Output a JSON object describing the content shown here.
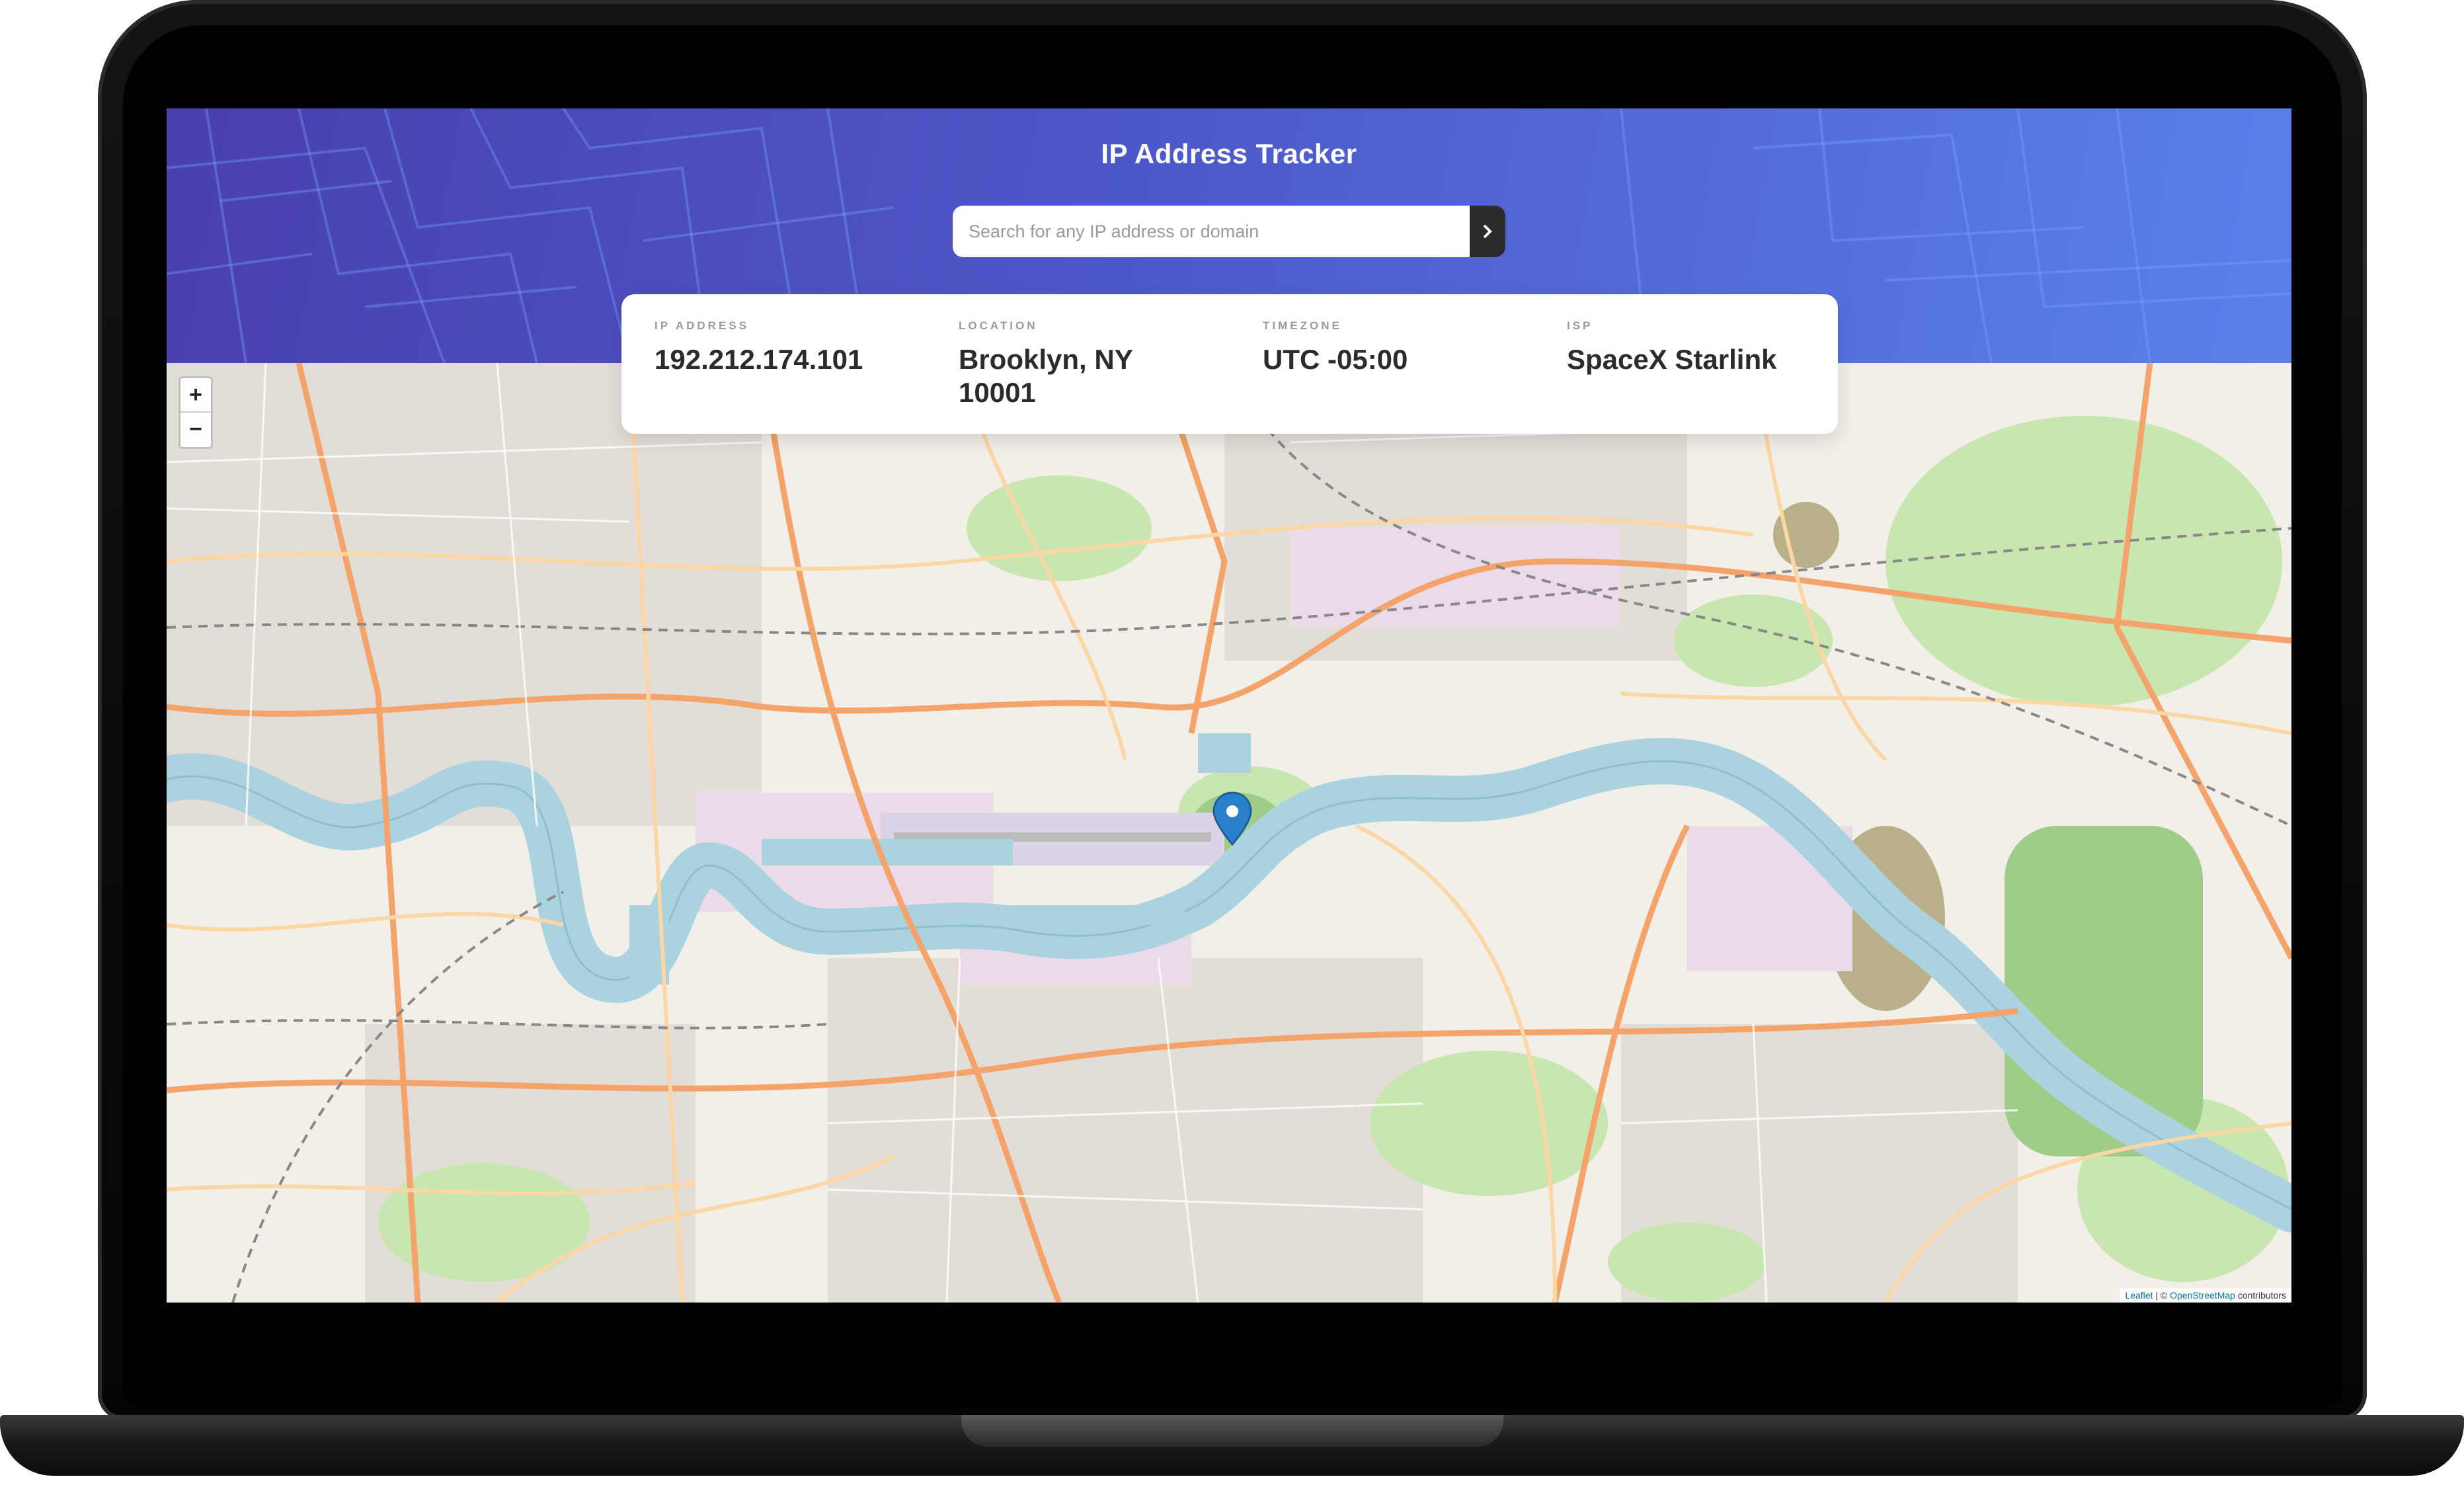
{
  "app": {
    "title": "IP Address Tracker"
  },
  "search": {
    "placeholder": "Search for any IP address or domain",
    "value": ""
  },
  "info": [
    {
      "label": "IP ADDRESS",
      "value": "192.212.174.101"
    },
    {
      "label": "LOCATION",
      "value": "Brooklyn, NY 10001"
    },
    {
      "label": "TIMEZONE",
      "value": "UTC -05:00"
    },
    {
      "label": "ISP",
      "value": "SpaceX Starlink"
    }
  ],
  "map": {
    "zoom_in": "+",
    "zoom_out": "−",
    "attribution": {
      "leaflet": "Leaflet",
      "separator": " | © ",
      "osm": "OpenStreetMap",
      "suffix": " contributors"
    },
    "colors": {
      "water": "#aad3df",
      "land": "#f2efe9",
      "park": "#c8e6b0",
      "residential": "#e0dfdf",
      "road_major": "#f4a36a",
      "road_primary": "#fcd6a4",
      "marker": "#2a81cb"
    }
  },
  "colors": {
    "header_start": "#4a3fb0",
    "header_end": "#5a80ea",
    "card_text": "#2b2b2b",
    "label_text": "#9a9a9a",
    "button": "#2b2b2b"
  }
}
